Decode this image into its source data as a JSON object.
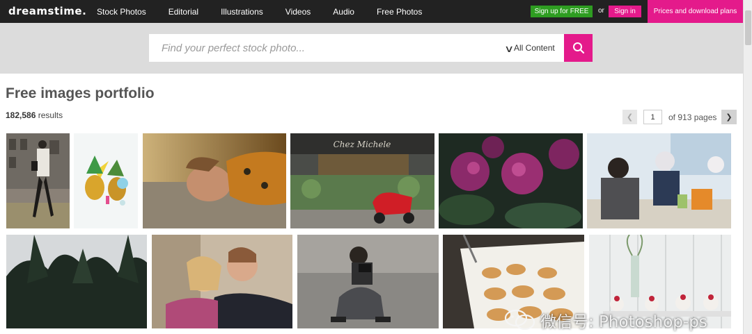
{
  "header": {
    "logo": "dreamstime.",
    "nav": [
      "Stock Photos",
      "Editorial",
      "Illustrations",
      "Videos",
      "Audio",
      "Free Photos"
    ],
    "signup_label": "Sign up for FREE",
    "or_label": "or",
    "signin_label": "Sign in",
    "prices_label": "Prices and download plans"
  },
  "search": {
    "placeholder": "Find your perfect stock photo...",
    "content_filter": "All Content",
    "button_icon": "search-icon"
  },
  "page": {
    "title": "Free images portfolio",
    "results_count": "182,586",
    "results_label": "results"
  },
  "pagination": {
    "current_page": "1",
    "of_label": "of 913 pages"
  },
  "gallery": {
    "row1": [
      "woman-walking-city-street-photo",
      "pineapples-party-hat-illustration",
      "woman-lying-on-ground-photo",
      "flower-shop-red-scooter-photo",
      "pink-rhododendron-flowers-photo",
      "couple-at-table-photo"
    ],
    "row2": [
      "palm-leaves-silhouette-photo",
      "couple-kissing-photo",
      "photographer-crouching-photo",
      "pastries-on-tray-photo",
      "desserts-white-table-photo"
    ]
  },
  "watermark": {
    "icon": "wechat-icon",
    "text": "微信号: Photoshop-ps"
  },
  "colors": {
    "topbar": "#222222",
    "signup_green": "#2e9d21",
    "accent_pink": "#e41a8b",
    "search_band": "#dcdcdc"
  }
}
